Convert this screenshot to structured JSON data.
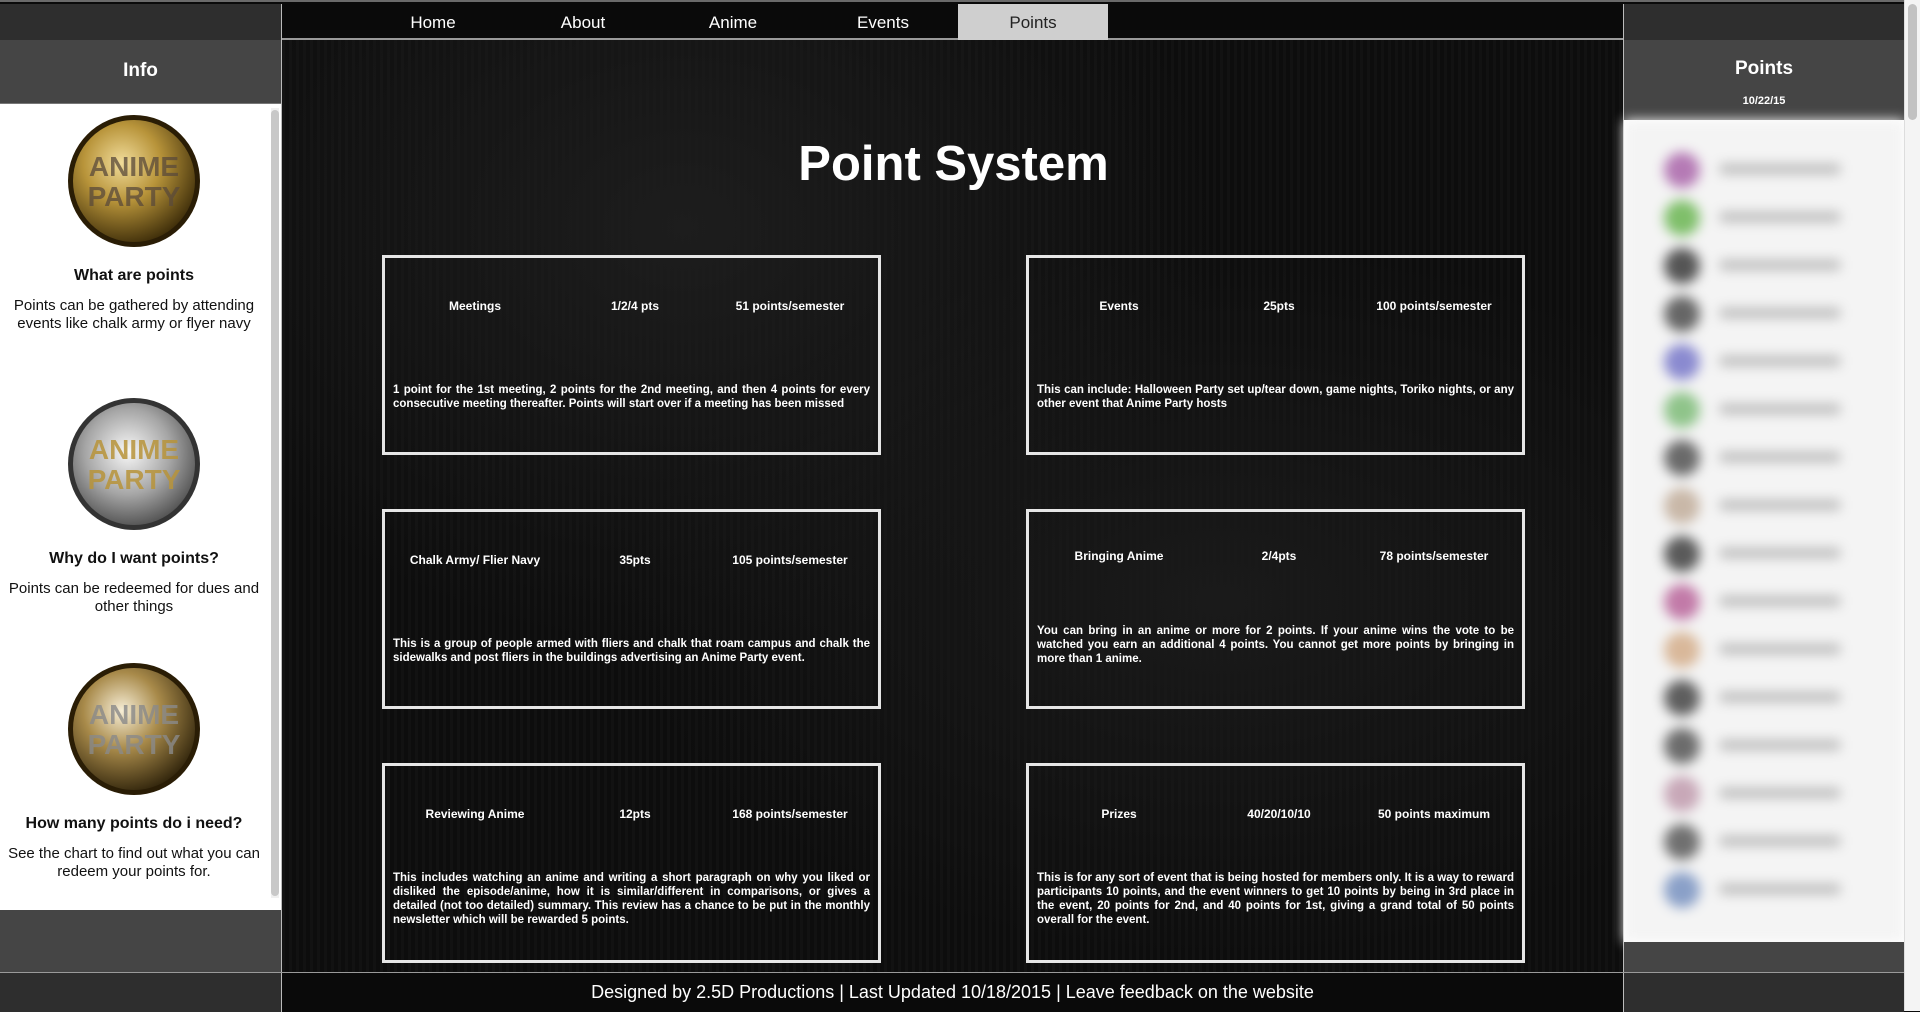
{
  "nav": {
    "items": [
      {
        "label": "Home"
      },
      {
        "label": "About"
      },
      {
        "label": "Anime"
      },
      {
        "label": "Events"
      },
      {
        "label": "Points",
        "active": true
      }
    ]
  },
  "left_sidebar": {
    "title": "Info",
    "badge_text": "ANIME PARTY",
    "sections": [
      {
        "badge_style": "gold",
        "question": "What are points",
        "answer": "Points can be gathered by attending events like chalk army or flyer navy"
      },
      {
        "badge_style": "silver",
        "question": "Why do I want points?",
        "answer": "Points can be redeemed for dues and other things"
      },
      {
        "badge_style": "gold",
        "question": "How many points do i need?",
        "answer": "See the chart to find out what you can redeem your points for."
      }
    ]
  },
  "main": {
    "title": "Point System",
    "cards": [
      {
        "name": "Meetings",
        "points": "1/2/4 pts",
        "limit": "51 points/semester",
        "description": "1 point for the 1st meeting, 2 points for the 2nd meeting, and then 4 points for every consecutive meeting thereafter. Points will start over if a meeting has been missed"
      },
      {
        "name": "Events",
        "points": "25pts",
        "limit": "100 points/semester",
        "description": "This can include: Halloween Party set up/tear down, game nights, Toriko nights, or any other event that Anime Party hosts"
      },
      {
        "name": "Chalk Army/ Flier Navy",
        "points": "35pts",
        "limit": "105 points/semester",
        "description": "This is a group of people armed with fliers and chalk that roam campus and chalk the sidewalks and post fliers in the buildings advertising an Anime Party event."
      },
      {
        "name": "Bringing Anime",
        "points": "2/4pts",
        "limit": "78 points/semester",
        "description": "You can bring in an anime or more for 2 points. If your anime wins the vote to be watched you earn an additional 4 points. You cannot get more points by bringing in more than 1 anime."
      },
      {
        "name": "Reviewing Anime",
        "points": "12pts",
        "limit": "168 points/semester",
        "description": "This includes watching an anime and writing a short paragraph on why you liked or disliked the episode/anime, how it is similar/different in comparisons, or gives a detailed (not too detailed) summary. This review has a chance to be put in the monthly newsletter which will be rewarded 5 points."
      },
      {
        "name": "Prizes",
        "points": "40/20/10/10",
        "limit": "50 points maximum",
        "description": "This is for any sort of event that is being hosted for members only. It is a way to reward participants 10 points, and the event winners to get 10 points by being in 3rd place in the event, 20 points for 2nd, and 40 points for 1st, giving a grand total of 50 points overall for the event."
      }
    ]
  },
  "right_sidebar": {
    "title": "Points",
    "date": "10/22/15",
    "blurred_row_colors": [
      "#b57ab5",
      "#7fbf6a",
      "#555555",
      "#666666",
      "#8a8ad0",
      "#8fc48a",
      "#6a6a6a",
      "#c9b8a8",
      "#5a5a5a",
      "#c27aa8",
      "#d9b89a",
      "#5e5e5e",
      "#6c6c6c",
      "#c8a8b8",
      "#707070",
      "#8aa0c8"
    ]
  },
  "footer": {
    "text": "Designed by 2.5D Productions | Last Updated 10/18/2015 | Leave feedback on the website"
  },
  "colors": {
    "panel_header": "#454545",
    "nav_active": "#cfcfcf",
    "gold": "#b8943a",
    "silver": "#a0a0a0"
  }
}
